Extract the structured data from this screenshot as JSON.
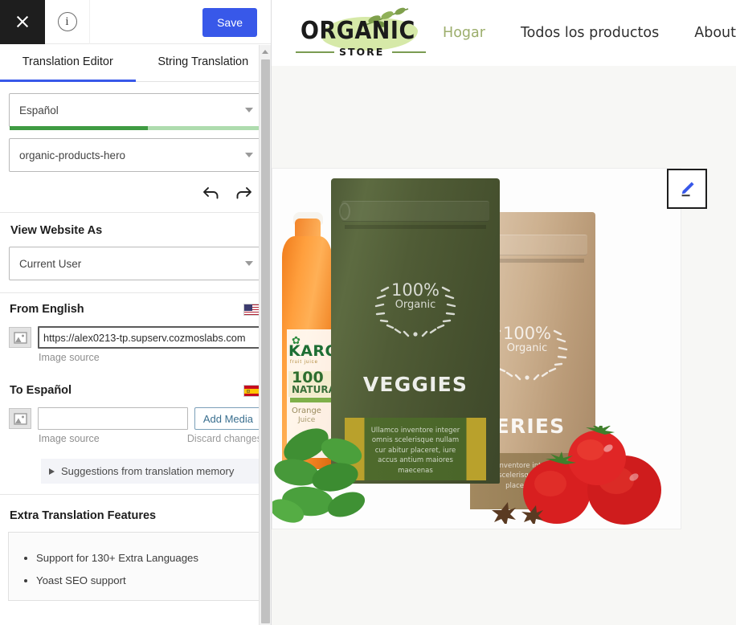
{
  "sidebar": {
    "topbar": {
      "close_icon": "close-icon",
      "info_icon": "info-icon",
      "info_glyph": "i",
      "save_label": "Save"
    },
    "tabs": [
      {
        "label": "Translation Editor",
        "active": true
      },
      {
        "label": "String Translation",
        "active": false
      }
    ],
    "language_select": {
      "value": "Español",
      "progress_percent": 55
    },
    "string_select": {
      "value": "organic-products-hero"
    },
    "history": {
      "undo_icon": "undo-arrow-icon",
      "redo_icon": "redo-arrow-icon"
    },
    "view_website_as": {
      "title": "View Website As",
      "value": "Current User"
    },
    "from_language": {
      "title": "From English",
      "flag": "us-flag-icon",
      "image_icon": "image-placeholder-icon",
      "value": "https://alex0213-tp.supserv.cozmoslabs.com",
      "caption": "Image source"
    },
    "to_language": {
      "title": "To Español",
      "flag": "es-flag-icon",
      "image_icon": "image-placeholder-icon",
      "value": "",
      "placeholder": "",
      "add_media_label": "Add Media",
      "caption": "Image source",
      "discard_label": "Discard changes"
    },
    "suggestions": {
      "label": "Suggestions from translation memory",
      "expander_icon": "triangle-right-icon"
    },
    "extra_features": {
      "title": "Extra Translation Features",
      "items": [
        "Support for 130+ Extra Languages",
        "Yoast SEO support"
      ]
    },
    "scrollbar": {
      "up_icon": "scroll-up-arrow-icon"
    }
  },
  "preview": {
    "logo": {
      "primary": "ORGANIC",
      "secondary": "STORE",
      "blob_color": "#d6e9a8"
    },
    "nav": [
      {
        "label": "Hogar",
        "active": true
      },
      {
        "label": "Todos los productos",
        "active": false
      },
      {
        "label": "About",
        "active": false
      }
    ],
    "edit_button": {
      "icon": "pencil-edit-icon",
      "accent_color": "#3858e9"
    },
    "hero_image": {
      "bags": [
        {
          "name": "VEGGIES",
          "badge_percent": "100%",
          "badge_word": "Organic",
          "label_text": "Ullamco inventore integer omnis scelerisque nullam cur abitur placeret, iure accus antium maiores maecenas",
          "color": "#505c36"
        },
        {
          "name": "OCERIES",
          "badge_percent": "100%",
          "badge_word": "Organic",
          "label_text": "inventore integer scelerisque nulla placeret iure",
          "color": "#cdb190"
        }
      ],
      "bottle": {
        "brand": "KARO",
        "sub": "fruit juice",
        "percent": "100",
        "natural": "NATURAL",
        "flavor": "Orange",
        "kind": "Juice"
      }
    }
  },
  "colors": {
    "accent_blue": "#3858e9",
    "progress_green": "#3f9b42",
    "nav_active_green": "#9cae6c"
  }
}
